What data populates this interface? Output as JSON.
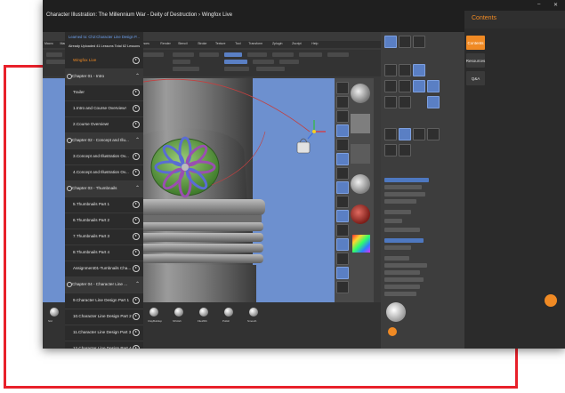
{
  "app": {
    "course_title": "Character Illustration: The Millennium War - Deity of Destruction  ›  Wingfox Live"
  },
  "window_controls": {
    "minimize": "–",
    "close": "✕"
  },
  "sidebar_tabs": [
    {
      "label": "Contents",
      "active": true
    },
    {
      "label": "Resources",
      "active": false
    },
    {
      "label": "Q&A",
      "active": false
    }
  ],
  "contents": {
    "title": "Contents",
    "learned": "Learned to: Ch2:Character Line Design P...",
    "uploaded": "Already Uploaded 41 Lessons   Total 62 Lessons",
    "rows": [
      {
        "kind": "lesson",
        "label": "Wingfox Live",
        "accent": true
      },
      {
        "kind": "chapter",
        "label": "Chapter 01 - Intro"
      },
      {
        "kind": "lesson",
        "label": "Trailer"
      },
      {
        "kind": "lesson",
        "label": "1.Intro and Course Overview!"
      },
      {
        "kind": "lesson",
        "label": "2.Course Overview!"
      },
      {
        "kind": "chapter",
        "label": "Chapter 02 - Concept and Illu..."
      },
      {
        "kind": "lesson",
        "label": "3.Concept and Illustration Ov..."
      },
      {
        "kind": "lesson",
        "label": "4.Concept and Illustration Ov..."
      },
      {
        "kind": "chapter",
        "label": "Chapter 03 - Thumbnails"
      },
      {
        "kind": "lesson",
        "label": "5.Thumbnails Part 1"
      },
      {
        "kind": "lesson",
        "label": "6.Thumbnails Part 2"
      },
      {
        "kind": "lesson",
        "label": "7.Thumbnails Part 3"
      },
      {
        "kind": "lesson",
        "label": "8.Thumbnails Part 4"
      },
      {
        "kind": "lesson",
        "label": "Assignment01-Tumbnails Cha..."
      },
      {
        "kind": "chapter",
        "label": "Chapter 04 - Character Line ..."
      },
      {
        "kind": "lesson",
        "label": "9.Character Line Design Part 1"
      },
      {
        "kind": "lesson",
        "label": "10.Character Line Design Part 2"
      },
      {
        "kind": "lesson",
        "label": "11.Character Line Design Part 3"
      },
      {
        "kind": "lesson",
        "label": "12.Character Line Design Part 4"
      },
      {
        "kind": "lesson",
        "label": "13.Character Line Design Part 5"
      }
    ]
  },
  "zbrush": {
    "menu": [
      "Macro",
      "Marker",
      "Material",
      "Movie",
      "Picker",
      "Preferences",
      "Render",
      "Stencil",
      "Stroke",
      "Texture",
      "Tool",
      "Transform",
      "Zplugin",
      "Zscript",
      "Help"
    ],
    "shelf": [
      "Std",
      "DNGSTRE",
      "Move",
      "MoCap",
      "ClayBuildup",
      "hPolish",
      "FileWith",
      "Polish",
      "Smooth"
    ]
  },
  "colors": {
    "accent": "#f08a24",
    "frame": "#e8202a",
    "canvas": "#6d90cf",
    "link": "#6ea2f0"
  }
}
